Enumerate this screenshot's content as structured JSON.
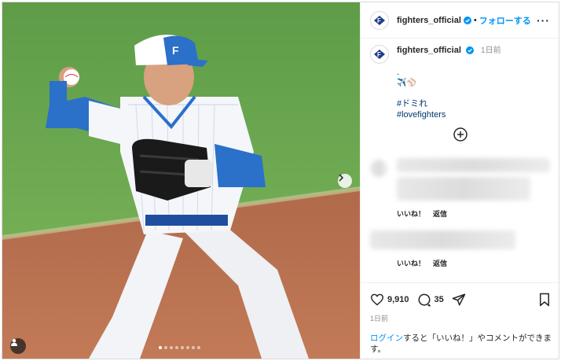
{
  "post": {
    "image_alt": "Fighters infielder in white striped uniform and blue cap throwing a baseball",
    "carousel_dots": 8,
    "carousel_active": 0,
    "next_icon": "chevron-right-icon",
    "tag_icon": "person-tag-icon"
  },
  "header": {
    "username": "fighters_official",
    "separator": "•",
    "follow_label": "フォローする",
    "more_label": "···"
  },
  "caption": {
    "username": "fighters_official",
    "time": "1日前",
    "line1": ".",
    "emoji": "✈️⚾",
    "hashtags": [
      "#ドミれ",
      "#lovefighters"
    ]
  },
  "comments": [
    {
      "like_label": "いいね！",
      "reply_label": "返信"
    },
    {
      "like_label": "いいね！",
      "reply_label": "返信"
    }
  ],
  "actions": {
    "likes": "9,910",
    "comments": "35",
    "date": "1日前"
  },
  "login": {
    "link_text": "ログイン",
    "rest_text": "すると「いいね！」やコメントができます。"
  },
  "colors": {
    "accent": "#0095f6",
    "verified": "#0095f6",
    "hashtag": "#00376b",
    "muted": "#8e8e8e"
  }
}
